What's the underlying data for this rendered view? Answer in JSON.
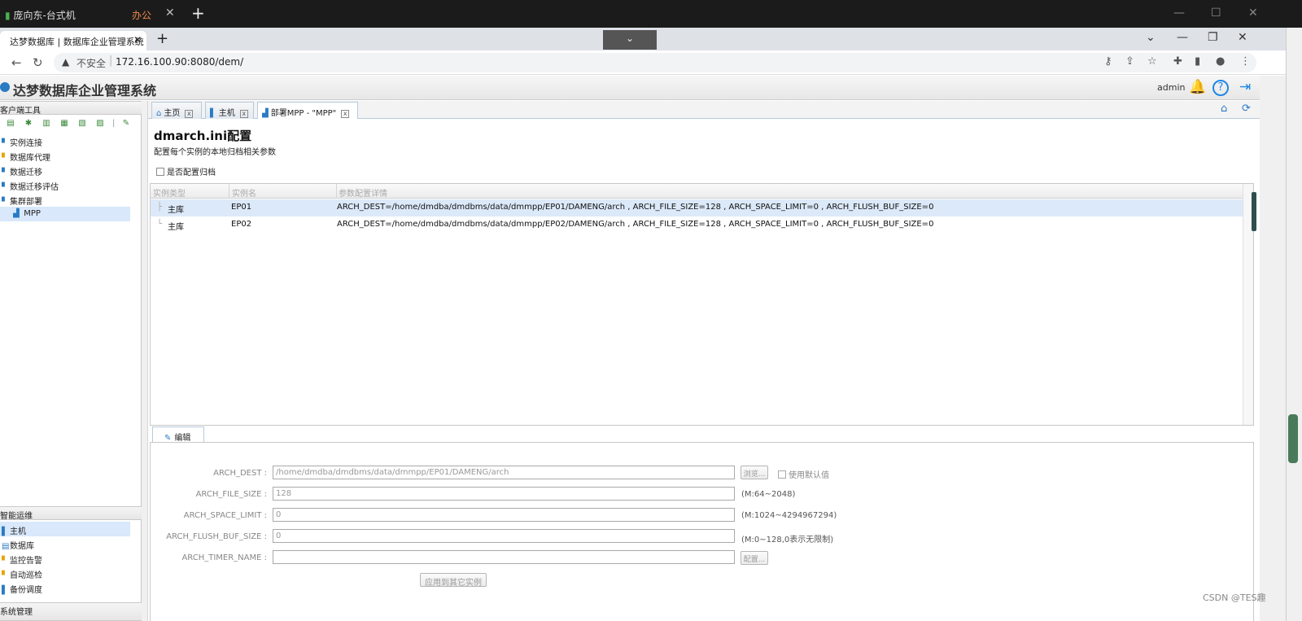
{
  "os": {
    "tab1": "庞向东-台式机",
    "tab2": "办公",
    "tab_close": "✕",
    "new_tab": "+",
    "min": "—",
    "max": "☐",
    "close": "✕"
  },
  "browser": {
    "tab_title": "达梦数据库 | 数据库企业管理系统",
    "tab_close": "✕",
    "new_tab": "+",
    "dropdown": "⌄",
    "win_chevron": "⌄",
    "win_min": "—",
    "win_restore": "❐",
    "win_close": "✕",
    "back": "←",
    "forward": "→",
    "reload": "↻",
    "warning": "▲",
    "insecure": "不安全",
    "url": "172.16.100.90:8080/dem/"
  },
  "app": {
    "title": "达梦数据库企业管理系统",
    "user": "admin"
  },
  "left": {
    "client_tools_header": "客户端工具",
    "client_tree": [
      {
        "label": "实例连接"
      },
      {
        "label": "数据库代理"
      },
      {
        "label": "数据迁移"
      },
      {
        "label": "数据迁移评估"
      },
      {
        "label": "集群部署"
      },
      {
        "label": "MPP"
      }
    ],
    "ops_header": "智能运维",
    "ops_tree": [
      {
        "label": "主机"
      },
      {
        "label": "数据库"
      },
      {
        "label": "监控告警"
      },
      {
        "label": "自动巡检"
      },
      {
        "label": "备份调度"
      }
    ],
    "bottom_header": "系统管理"
  },
  "tabs": [
    {
      "label": "主页"
    },
    {
      "label": "主机"
    },
    {
      "label": "部署MPP - \"MPP\""
    }
  ],
  "page": {
    "title": "dmarch.ini配置",
    "subtitle": "配置每个实例的本地归档相关参数",
    "config_archive_label": "是否配置归档"
  },
  "grid": {
    "headers": [
      "实例类型",
      "实例名",
      "参数配置详情"
    ],
    "rows": [
      {
        "type": "主库",
        "name": "EP01",
        "detail": "ARCH_DEST=/home/dmdba/dmdbms/data/dmmpp/EP01/DAMENG/arch , ARCH_FILE_SIZE=128 , ARCH_SPACE_LIMIT=0 , ARCH_FLUSH_BUF_SIZE=0"
      },
      {
        "type": "主库",
        "name": "EP02",
        "detail": "ARCH_DEST=/home/dmdba/dmdbms/data/dmmpp/EP02/DAMENG/arch , ARCH_FILE_SIZE=128 , ARCH_SPACE_LIMIT=0 , ARCH_FLUSH_BUF_SIZE=0"
      }
    ]
  },
  "edit": {
    "tab_label": "编辑",
    "fields": {
      "arch_dest": {
        "label": "ARCH_DEST :",
        "value": "/home/dmdba/dmdbms/data/dmmpp/EP01/DAMENG/arch"
      },
      "arch_file_size": {
        "label": "ARCH_FILE_SIZE :",
        "value": "128",
        "hint": "(M:64~2048)"
      },
      "arch_space_limit": {
        "label": "ARCH_SPACE_LIMIT :",
        "value": "0",
        "hint": "(M:1024~4294967294)"
      },
      "arch_flush_buf_size": {
        "label": "ARCH_FLUSH_BUF_SIZE :",
        "value": "0",
        "hint": "(M:0~128,0表示无限制)"
      },
      "arch_timer_name": {
        "label": "ARCH_TIMER_NAME :",
        "value": ""
      }
    },
    "browse_button": "浏览...",
    "use_default": "使用默认值",
    "config_button": "配置...",
    "apply_button": "应用到其它实例"
  },
  "watermark": "CSDN @TES趣"
}
